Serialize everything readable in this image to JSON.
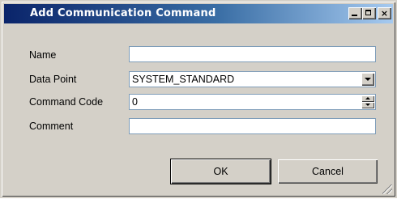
{
  "window": {
    "title": "Add Communication Command",
    "minimize_label": "_",
    "maximize_label": "",
    "close_label": "×"
  },
  "form": {
    "name": {
      "label": "Name",
      "value": ""
    },
    "data_point": {
      "label": "Data Point",
      "value": "SYSTEM_STANDARD"
    },
    "command_code": {
      "label": "Command Code",
      "value": "0"
    },
    "comment": {
      "label": "Comment",
      "value": ""
    }
  },
  "buttons": {
    "ok": "OK",
    "cancel": "Cancel"
  }
}
